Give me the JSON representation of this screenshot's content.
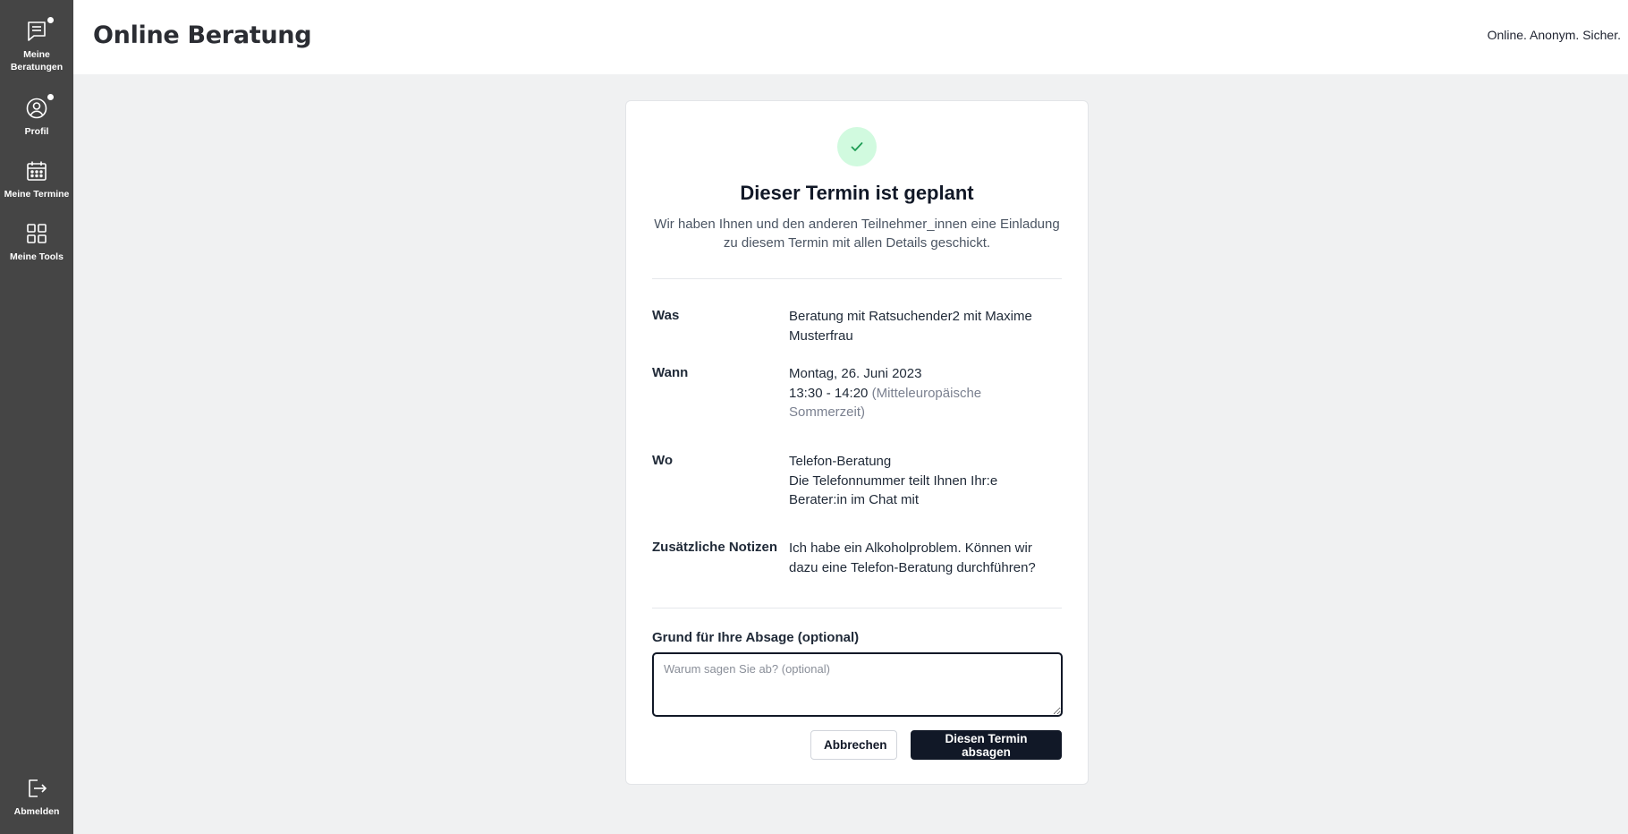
{
  "app": {
    "title": "Online Beratung",
    "claim": "Online. Anonym. Sicher."
  },
  "sidebar": {
    "items": [
      {
        "label": "Meine Beratungen",
        "icon": "chat-list-icon",
        "has_notification": true
      },
      {
        "label": "Profil",
        "icon": "user-circle-icon",
        "has_notification": true
      },
      {
        "label": "Meine Termine",
        "icon": "calendar-icon",
        "has_notification": false
      },
      {
        "label": "Meine Tools",
        "icon": "grid-icon",
        "has_notification": false
      }
    ],
    "logout_label": "Abmelden"
  },
  "booking": {
    "status_icon": "check-icon",
    "heading": "Dieser Termin ist geplant",
    "intro": "Wir haben Ihnen und den anderen Teilnehmer_innen eine Einladung zu diesem Termin mit allen Details geschickt.",
    "what_label": "Was",
    "what_value": "Beratung mit Ratsuchender2 mit Maxime Musterfrau",
    "when_label": "Wann",
    "when_date": "Montag, 26. Juni 2023",
    "when_time": "13:30 - 14:20",
    "when_timezone": "(Mitteleuropäische Sommerzeit)",
    "where_label": "Wo",
    "where_type": "Telefon-Beratung",
    "where_note": "Die Telefonnummer teilt Ihnen Ihr:e Berater:in im Chat mit",
    "notes_label": "Zusätzliche Notizen",
    "notes_value": "Ich habe ein Alkoholproblem. Können wir dazu eine Telefon-Beratung durchführen?"
  },
  "cancellation": {
    "reason_label": "Grund für Ihre Absage (optional)",
    "reason_placeholder": "Warum sagen Sie ab? (optional)",
    "reason_value": "",
    "cancel_button": "Abbrechen",
    "confirm_button": "Diesen Termin absagen"
  },
  "colors": {
    "sidebar_bg": "#454545",
    "page_bg": "#f0f1f2",
    "primary_button": "#111827",
    "success_circle": "#d1fadf",
    "success_check": "#1f9d55"
  }
}
